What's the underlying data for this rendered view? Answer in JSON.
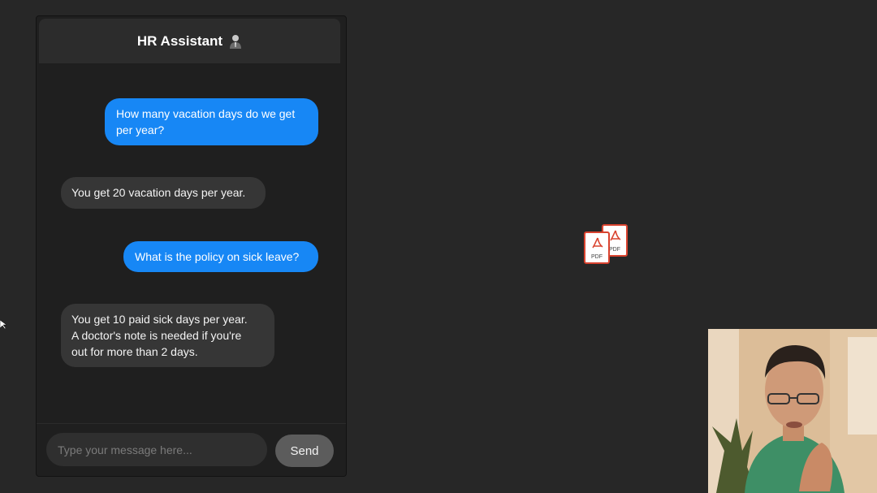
{
  "chat": {
    "title": "HR Assistant",
    "header_icon": "person-icon",
    "messages": [
      {
        "role": "user",
        "text": "How many vacation days do we get\nper year?"
      },
      {
        "role": "bot",
        "text": "You get 20 vacation days per year."
      },
      {
        "role": "user",
        "text": "What is the policy on sick leave?"
      },
      {
        "role": "bot",
        "text": "You get 10 paid sick days per year.\nA doctor's note is needed if you're\nout for more than 2 days."
      }
    ],
    "input": {
      "placeholder": "Type your message here...",
      "value": ""
    },
    "send_label": "Send"
  },
  "pdf_icons": {
    "label": "PDF"
  },
  "colors": {
    "background": "#272727",
    "user_bubble": "#1787f5",
    "bot_bubble": "#363636",
    "pdf_accent": "#d9432f"
  }
}
